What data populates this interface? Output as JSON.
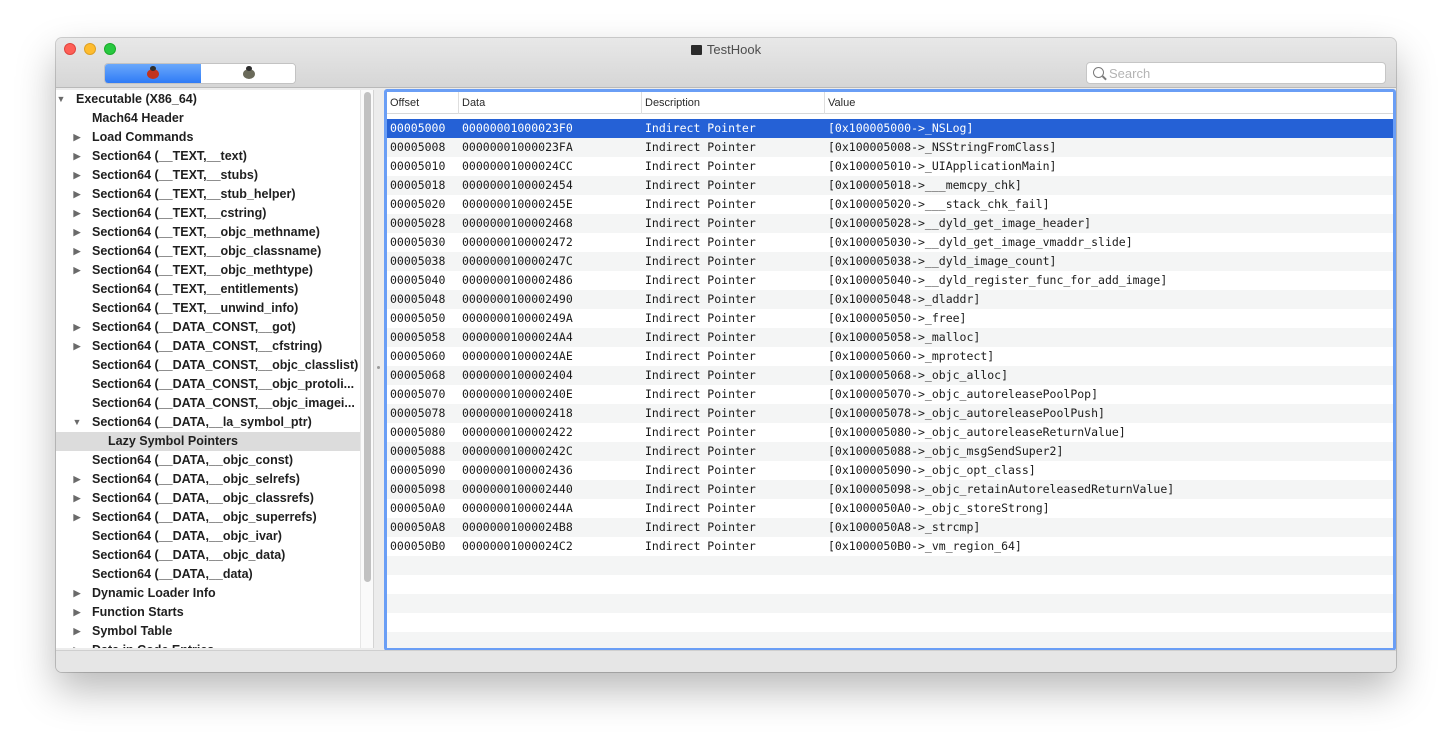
{
  "window": {
    "title": "TestHook",
    "colors": {
      "close": "#fe5f57",
      "minimize": "#febc2e",
      "zoom": "#28c840",
      "selection": "#2561d6",
      "focus_ring": "#6a9ef5"
    }
  },
  "toolbar": {
    "segments": [
      {
        "icon": "red-bug-icon",
        "color": "#c2341f",
        "selected": true
      },
      {
        "icon": "gray-bug-icon",
        "color": "#6a6a5a",
        "selected": false
      }
    ],
    "search": {
      "placeholder": "Search",
      "value": ""
    }
  },
  "sidebar": {
    "items": [
      {
        "label": "Executable  (X86_64)",
        "level": 0,
        "disclosure": "expanded"
      },
      {
        "label": "Mach64 Header",
        "level": 1,
        "disclosure": "none"
      },
      {
        "label": "Load Commands",
        "level": 1,
        "disclosure": "collapsed"
      },
      {
        "label": "Section64 (__TEXT,__text)",
        "level": 1,
        "disclosure": "collapsed"
      },
      {
        "label": "Section64 (__TEXT,__stubs)",
        "level": 1,
        "disclosure": "collapsed"
      },
      {
        "label": "Section64 (__TEXT,__stub_helper)",
        "level": 1,
        "disclosure": "collapsed"
      },
      {
        "label": "Section64 (__TEXT,__cstring)",
        "level": 1,
        "disclosure": "collapsed"
      },
      {
        "label": "Section64 (__TEXT,__objc_methname)",
        "level": 1,
        "disclosure": "collapsed"
      },
      {
        "label": "Section64 (__TEXT,__objc_classname)",
        "level": 1,
        "disclosure": "collapsed"
      },
      {
        "label": "Section64 (__TEXT,__objc_methtype)",
        "level": 1,
        "disclosure": "collapsed"
      },
      {
        "label": "Section64 (__TEXT,__entitlements)",
        "level": 1,
        "disclosure": "none"
      },
      {
        "label": "Section64 (__TEXT,__unwind_info)",
        "level": 1,
        "disclosure": "none"
      },
      {
        "label": "Section64 (__DATA_CONST,__got)",
        "level": 1,
        "disclosure": "collapsed"
      },
      {
        "label": "Section64 (__DATA_CONST,__cfstring)",
        "level": 1,
        "disclosure": "collapsed"
      },
      {
        "label": "Section64 (__DATA_CONST,__objc_classlist)",
        "level": 1,
        "disclosure": "none"
      },
      {
        "label": "Section64 (__DATA_CONST,__objc_protoli...",
        "level": 1,
        "disclosure": "none"
      },
      {
        "label": "Section64 (__DATA_CONST,__objc_imagei...",
        "level": 1,
        "disclosure": "none"
      },
      {
        "label": "Section64 (__DATA,__la_symbol_ptr)",
        "level": 1,
        "disclosure": "expanded"
      },
      {
        "label": "Lazy Symbol Pointers",
        "level": 2,
        "disclosure": "none",
        "selected": true
      },
      {
        "label": "Section64 (__DATA,__objc_const)",
        "level": 1,
        "disclosure": "none"
      },
      {
        "label": "Section64 (__DATA,__objc_selrefs)",
        "level": 1,
        "disclosure": "collapsed"
      },
      {
        "label": "Section64 (__DATA,__objc_classrefs)",
        "level": 1,
        "disclosure": "collapsed"
      },
      {
        "label": "Section64 (__DATA,__objc_superrefs)",
        "level": 1,
        "disclosure": "collapsed"
      },
      {
        "label": "Section64 (__DATA,__objc_ivar)",
        "level": 1,
        "disclosure": "none"
      },
      {
        "label": "Section64 (__DATA,__objc_data)",
        "level": 1,
        "disclosure": "none"
      },
      {
        "label": "Section64 (__DATA,__data)",
        "level": 1,
        "disclosure": "none"
      },
      {
        "label": "Dynamic Loader Info",
        "level": 1,
        "disclosure": "collapsed"
      },
      {
        "label": "Function Starts",
        "level": 1,
        "disclosure": "collapsed"
      },
      {
        "label": "Symbol Table",
        "level": 1,
        "disclosure": "collapsed"
      },
      {
        "label": "Data in Code Entries",
        "level": 1,
        "disclosure": "collapsed"
      }
    ]
  },
  "table": {
    "columns": [
      "Offset",
      "Data",
      "Description",
      "Value"
    ],
    "rows": [
      [
        "00005000",
        "00000001000023F0",
        "Indirect Pointer",
        "[0x100005000->_NSLog]"
      ],
      [
        "00005008",
        "00000001000023FA",
        "Indirect Pointer",
        "[0x100005008->_NSStringFromClass]"
      ],
      [
        "00005010",
        "00000001000024CC",
        "Indirect Pointer",
        "[0x100005010->_UIApplicationMain]"
      ],
      [
        "00005018",
        "0000000100002454",
        "Indirect Pointer",
        "[0x100005018->___memcpy_chk]"
      ],
      [
        "00005020",
        "000000010000245E",
        "Indirect Pointer",
        "[0x100005020->___stack_chk_fail]"
      ],
      [
        "00005028",
        "0000000100002468",
        "Indirect Pointer",
        "[0x100005028->__dyld_get_image_header]"
      ],
      [
        "00005030",
        "0000000100002472",
        "Indirect Pointer",
        "[0x100005030->__dyld_get_image_vmaddr_slide]"
      ],
      [
        "00005038",
        "000000010000247C",
        "Indirect Pointer",
        "[0x100005038->__dyld_image_count]"
      ],
      [
        "00005040",
        "0000000100002486",
        "Indirect Pointer",
        "[0x100005040->__dyld_register_func_for_add_image]"
      ],
      [
        "00005048",
        "0000000100002490",
        "Indirect Pointer",
        "[0x100005048->_dladdr]"
      ],
      [
        "00005050",
        "000000010000249A",
        "Indirect Pointer",
        "[0x100005050->_free]"
      ],
      [
        "00005058",
        "00000001000024A4",
        "Indirect Pointer",
        "[0x100005058->_malloc]"
      ],
      [
        "00005060",
        "00000001000024AE",
        "Indirect Pointer",
        "[0x100005060->_mprotect]"
      ],
      [
        "00005068",
        "0000000100002404",
        "Indirect Pointer",
        "[0x100005068->_objc_alloc]"
      ],
      [
        "00005070",
        "000000010000240E",
        "Indirect Pointer",
        "[0x100005070->_objc_autoreleasePoolPop]"
      ],
      [
        "00005078",
        "0000000100002418",
        "Indirect Pointer",
        "[0x100005078->_objc_autoreleasePoolPush]"
      ],
      [
        "00005080",
        "0000000100002422",
        "Indirect Pointer",
        "[0x100005080->_objc_autoreleaseReturnValue]"
      ],
      [
        "00005088",
        "000000010000242C",
        "Indirect Pointer",
        "[0x100005088->_objc_msgSendSuper2]"
      ],
      [
        "00005090",
        "0000000100002436",
        "Indirect Pointer",
        "[0x100005090->_objc_opt_class]"
      ],
      [
        "00005098",
        "0000000100002440",
        "Indirect Pointer",
        "[0x100005098->_objc_retainAutoreleasedReturnValue]"
      ],
      [
        "000050A0",
        "000000010000244A",
        "Indirect Pointer",
        "[0x1000050A0->_objc_storeStrong]"
      ],
      [
        "000050A8",
        "00000001000024B8",
        "Indirect Pointer",
        "[0x1000050A8->_strcmp]"
      ],
      [
        "000050B0",
        "00000001000024C2",
        "Indirect Pointer",
        "[0x1000050B0->_vm_region_64]"
      ]
    ],
    "selected_row": 0
  }
}
